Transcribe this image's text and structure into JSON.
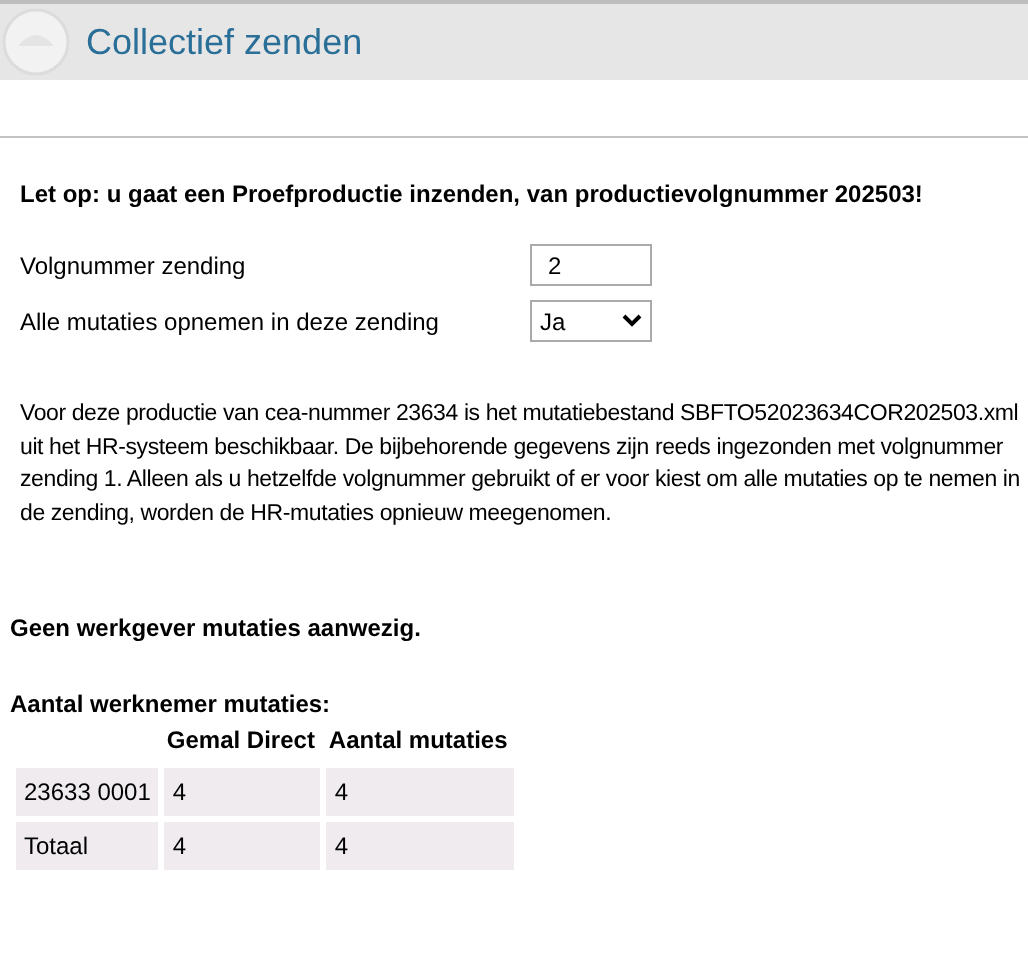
{
  "header": {
    "title": "Collectief zenden"
  },
  "warning": "Let op: u gaat een Proefproductie inzenden, van productievolgnummer 202503!",
  "fields": [
    {
      "kind": "input",
      "label": "Volgnummer zending",
      "value": "2"
    },
    {
      "kind": "select",
      "label": "Alle mutaties opnemen in deze zending",
      "value": "Ja"
    }
  ],
  "info": "Voor deze productie van cea-nummer 23634 is het mutatiebestand SBFTO52023634COR202503.xml uit het HR-systeem beschikbaar. De bijbehorende gegevens zijn reeds ingezonden met volgnummer zending 1. Alleen als u hetzelfde volgnummer gebruikt of er voor kiest om alle mutaties op te nemen in de zending, worden de HR-mutaties opnieuw meegenomen.",
  "employer_note": "Geen werkgever mutaties aanwezig.",
  "employee_heading": "Aantal werknemer mutaties:",
  "table": {
    "columns": [
      "",
      "Gemal Direct",
      "Aantal mutaties"
    ],
    "rows": [
      [
        "23633 0001",
        "4",
        "4"
      ],
      [
        "Totaal",
        "4",
        "4"
      ]
    ]
  }
}
